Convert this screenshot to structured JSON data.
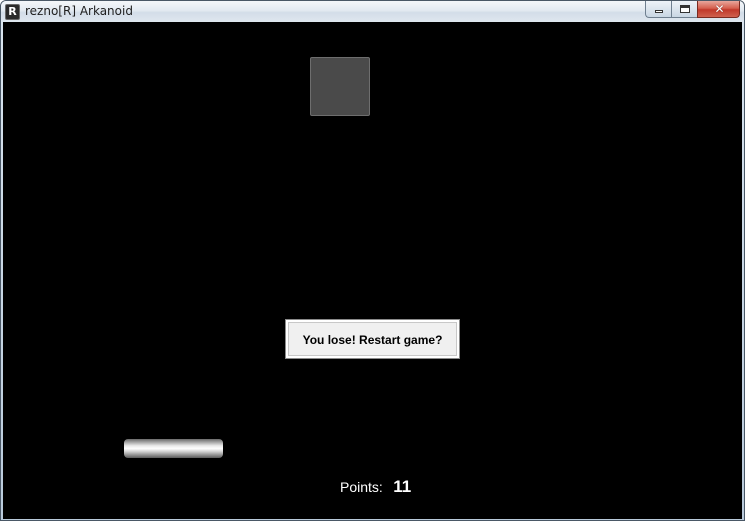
{
  "window": {
    "title": "rezno[R] Arkanoid",
    "icon_letter": "R",
    "icon": "app-r-icon"
  },
  "caption_buttons": {
    "minimize_icon": "minimize-icon",
    "maximize_icon": "maximize-icon",
    "close_icon": "close-icon",
    "close_glyph": "✕"
  },
  "game": {
    "background_color": "#000000",
    "brick_color": "#4a4a4a",
    "dialog": {
      "label": "You lose! Restart game?"
    },
    "score": {
      "label": "Points:",
      "value": "11"
    }
  }
}
